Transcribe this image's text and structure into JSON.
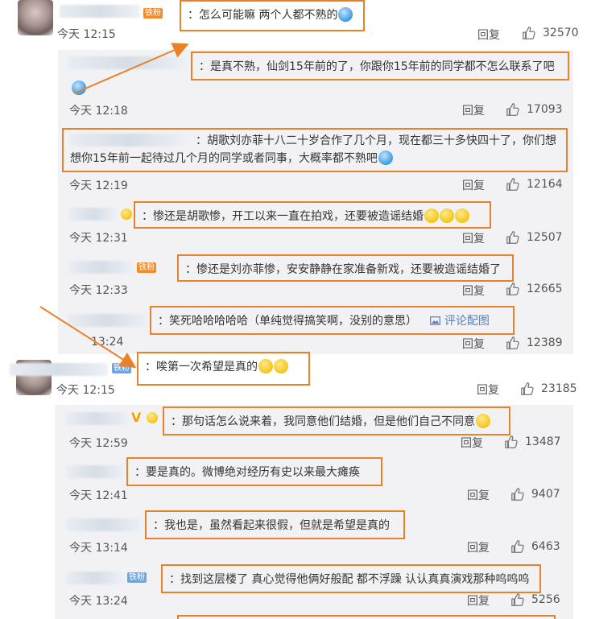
{
  "comments": [
    {
      "text": "：怎么可能嘛 两个人都不熟的",
      "badge": "铁粉",
      "time": "今天 12:15",
      "reply_label": "回复",
      "likes": "32570"
    },
    {
      "text": "：惨还是胡歌惨，开工以来一直在拍戏，还要被造谣结婚",
      "time": "今天 12:31"
    },
    {
      "text": "：唉第一次希望是真的",
      "badge": "铁粉",
      "time": "今天 12:15",
      "reply_label": "回复",
      "likes": "23185"
    }
  ],
  "thread1": [
    {
      "text": "：是真不熟，仙剑15年前的了，你跟你15年前的同学都不怎么联系了吧",
      "time": "今天 12:18",
      "reply_label": "回复",
      "likes": "17093"
    },
    {
      "text": "：胡歌刘亦菲十八二十岁合作了几个月，现在都三十多快四十了，你们想想你15年前一起待过几个月的同学或者同事，大概率都不熟吧",
      "time": "今天 12:19",
      "reply_label": "回复",
      "likes": "12164"
    },
    {
      "text": "：惨还是胡歌惨，开工以来一直在拍戏，还要被造谣结婚",
      "time": "今天 12:31",
      "reply_label": "回复",
      "likes": "12507"
    },
    {
      "text": "：惨还是刘亦菲惨，安安静静在家准备新戏，还要被造谣结婚了",
      "badge": "铁粉",
      "time": "今天 12:33",
      "reply_label": "回复",
      "likes": "12665"
    },
    {
      "text": "：笑死哈哈哈哈哈（单纯觉得搞笑啊，没别的意思）",
      "pic_label": "评论配图",
      "time": "13:24",
      "reply_label": "回复",
      "likes": "12389"
    }
  ],
  "thread2": [
    {
      "text": "：那句话怎么说来着，我同意他们结婚，但是他们自己不同意",
      "time": "今天 12:59",
      "reply_label": "回复",
      "likes": "13487"
    },
    {
      "text": "：要是真的。微博绝对经历有史以来最大瘫痪",
      "time": "今天 12:41",
      "reply_label": "回复",
      "likes": "9407"
    },
    {
      "text": "：我也是，虽然看起来很假，但就是希望是真的",
      "time": "今天 13:14",
      "reply_label": "回复",
      "likes": "6463"
    },
    {
      "text": "：找到这层楼了 真心觉得他俩好般配 都不浮躁 认认真真演戏那种呜呜呜",
      "badge": "铁粉",
      "time": "今天 13:24",
      "reply_label": "回复",
      "likes": "5256"
    }
  ],
  "colors": {
    "highlight": "#e8822a",
    "reply_bg": "#f2f2f5",
    "fan_badge_orange": "#f28c28",
    "fan_badge_blue": "#6aa7e6",
    "link": "#5a7fb5"
  },
  "icons": {
    "thumb": "thumbs-up-icon",
    "picture": "picture-icon",
    "emoji": "emoji-icon",
    "vip": "vip-v-icon"
  }
}
